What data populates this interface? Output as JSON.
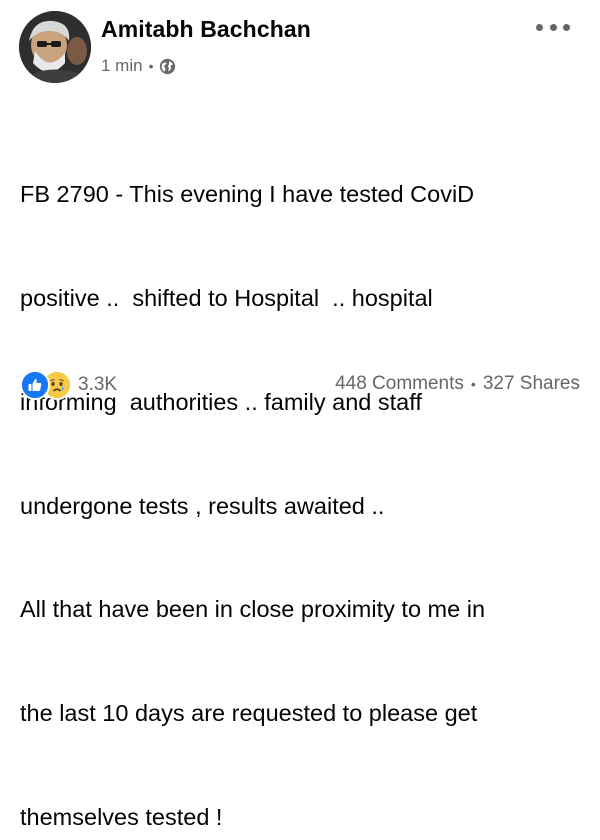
{
  "post": {
    "author": "Amitabh Bachchan",
    "time": "1 min",
    "meta_separator": "•",
    "audience_icon": "globe-icon",
    "more_icon": "more-options-icon",
    "text_lines": [
      "FB 2790 - This evening I have tested CoviD",
      "positive ..  shifted to Hospital  .. hospital",
      "informing  authorities .. family and staff",
      "undergone tests , results awaited ..",
      "All that have been in close proximity to me in",
      "the last 10 days are requested to please get",
      "themselves tested !"
    ]
  },
  "footer": {
    "reaction_icons": [
      "like-icon",
      "sad-icon"
    ],
    "reaction_count": "3.3K",
    "comments": "448 Comments",
    "separator": "•",
    "shares": "327 Shares"
  },
  "colors": {
    "text": "#050505",
    "secondary": "#65676b",
    "like_blue": "#1877f2",
    "sad_yellow": "#f7c948"
  }
}
